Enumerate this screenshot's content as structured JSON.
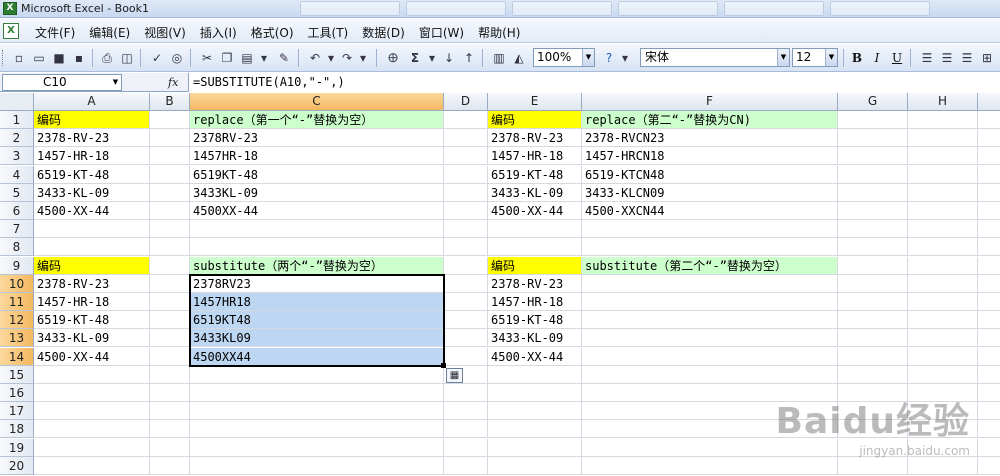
{
  "window": {
    "title": "Microsoft Excel - Book1",
    "app_icon": "X"
  },
  "menu": {
    "items": [
      "文件(F)",
      "编辑(E)",
      "视图(V)",
      "插入(I)",
      "格式(O)",
      "工具(T)",
      "数据(D)",
      "窗口(W)",
      "帮助(H)"
    ]
  },
  "toolbar": {
    "zoom": "100%",
    "font": "宋体",
    "font_size": "12",
    "bold": "B",
    "italic": "I",
    "underline": "U",
    "sigma": "Σ"
  },
  "formula_bar": {
    "name_box": "C10",
    "fx": "fx",
    "formula": "=SUBSTITUTE(A10,\"-\",)"
  },
  "grid": {
    "columns": [
      "A",
      "B",
      "C",
      "D",
      "E",
      "F",
      "G",
      "H"
    ],
    "rows": [
      "1",
      "2",
      "3",
      "4",
      "5",
      "6",
      "7",
      "8",
      "9",
      "10",
      "11",
      "12",
      "13",
      "14",
      "15",
      "16",
      "17",
      "18",
      "19",
      "20"
    ],
    "cells": {
      "A1": "编码",
      "C1": "replace（第一个“-”替换为空）",
      "E1": "编码",
      "F1": "replace（第二“-”替换为CN)",
      "A2": "2378-RV-23",
      "C2": "2378RV-23",
      "E2": "2378-RV-23",
      "F2": "2378-RVCN23",
      "A3": "1457-HR-18",
      "C3": "1457HR-18",
      "E3": "1457-HR-18",
      "F3": "1457-HRCN18",
      "A4": "6519-KT-48",
      "C4": "6519KT-48",
      "E4": "6519-KT-48",
      "F4": "6519-KTCN48",
      "A5": "3433-KL-09",
      "C5": "3433KL-09",
      "E5": "3433-KL-09",
      "F5": "3433-KLCN09",
      "A6": "4500-XX-44",
      "C6": "4500XX-44",
      "E6": "4500-XX-44",
      "F6": "4500-XXCN44",
      "A9": "编码",
      "C9": "substitute（两个“-”替换为空）",
      "E9": "编码",
      "F9": "substitute（第二个“-”替换为空）",
      "A10": "2378-RV-23",
      "C10": "2378RV23",
      "E10": "2378-RV-23",
      "A11": "1457-HR-18",
      "C11": "1457HR18",
      "E11": "1457-HR-18",
      "A12": "6519-KT-48",
      "C12": "6519KT48",
      "E12": "6519-KT-48",
      "A13": "3433-KL-09",
      "C13": "3433KL09",
      "E13": "3433-KL-09",
      "A14": "4500-XX-44",
      "C14": "4500XX44",
      "E14": "4500-XX-44"
    },
    "yellow_cells": [
      "A1",
      "E1",
      "A9",
      "E9"
    ],
    "green_cells": [
      "C1",
      "F1",
      "C9",
      "F9"
    ],
    "selected_range": "C10:C14",
    "active_column": "C",
    "active_rows": [
      "10",
      "11",
      "12",
      "13",
      "14"
    ]
  },
  "watermark": {
    "brand": "Baidu经验",
    "url": "jingyan.baidu.com"
  },
  "colors": {
    "header_yellow": "#ffff00",
    "header_green": "#ccffcc",
    "selection_blue": "#bdd7f3",
    "active_header": "#f3b860"
  }
}
